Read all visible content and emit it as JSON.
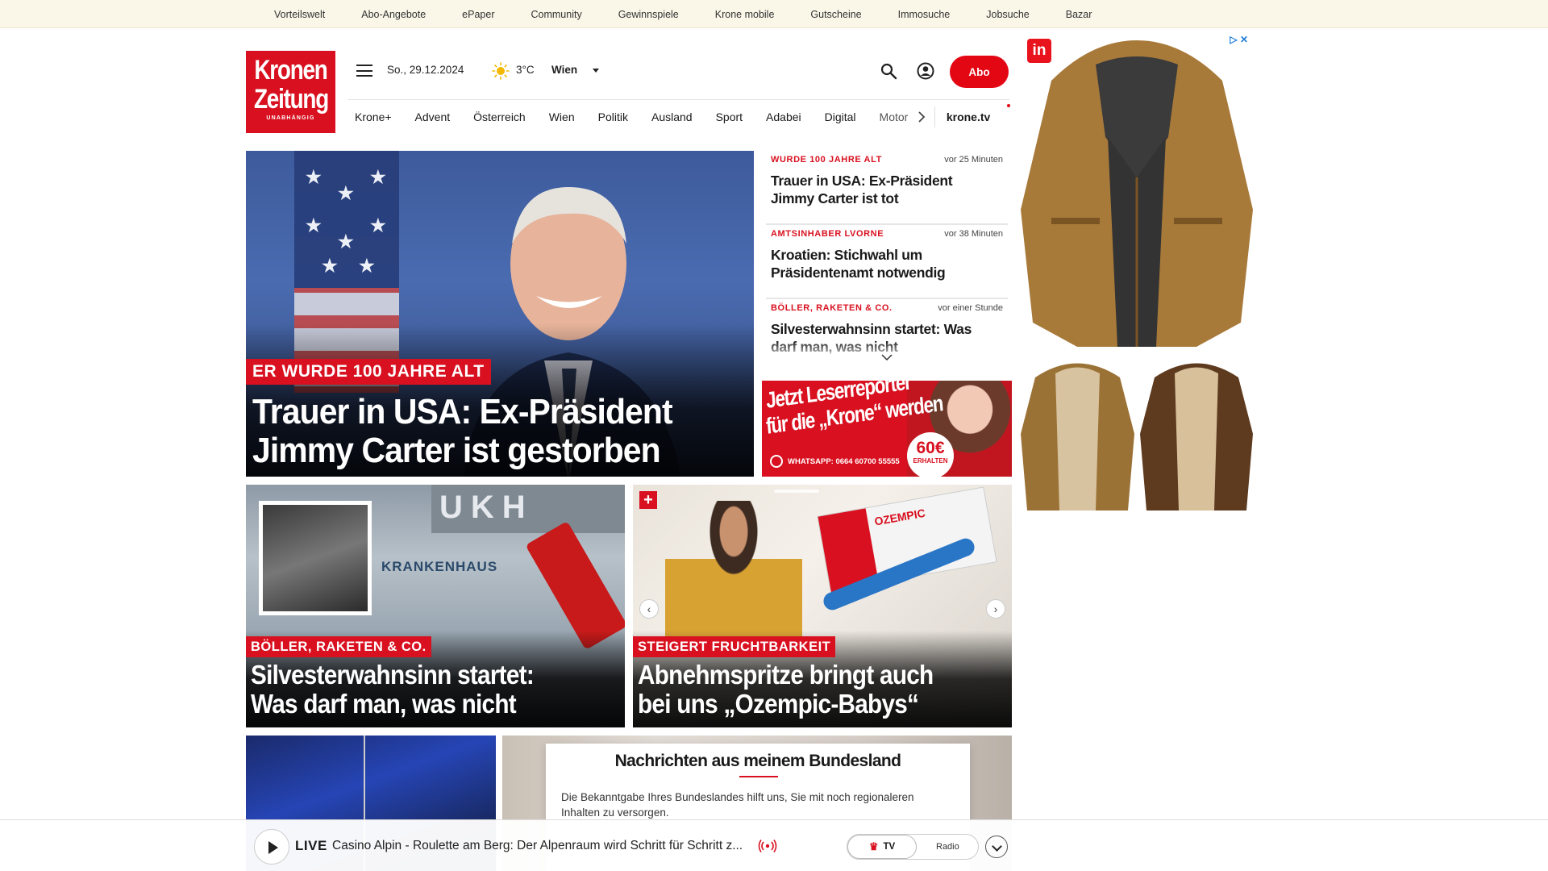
{
  "topbar": {
    "links": [
      "Vorteilswelt",
      "Abo-Angebote",
      "ePaper",
      "Community",
      "Gewinnspiele",
      "Krone mobile",
      "Gutscheine",
      "Immosuche",
      "Jobsuche",
      "Bazar"
    ]
  },
  "logo": {
    "line1": "Kronen",
    "line2": "Zeitung",
    "line3": "UNABHÄNGIG"
  },
  "header": {
    "date": "So., 29.12.2024",
    "temperature": "3°C",
    "city": "Wien",
    "abo_label": "Abo",
    "icons": {
      "menu": "hamburger-icon",
      "weather": "sun-icon",
      "search": "search-icon",
      "account": "user-icon"
    }
  },
  "nav": {
    "items": [
      "Krone+",
      "Advent",
      "Österreich",
      "Wien",
      "Politik",
      "Ausland",
      "Sport",
      "Adabei",
      "Digital",
      "Motor"
    ],
    "tv_label": "krone.tv"
  },
  "hero": {
    "kicker": "ER WURDE 100 JAHRE ALT",
    "title": "Trauer in USA: Ex-Präsident Jimmy Carter ist gestorben"
  },
  "news_list": [
    {
      "tag": "WURDE 100 JAHRE ALT",
      "time": "vor 25 Minuten",
      "headline": "Trauer in USA: Ex-Präsident Jimmy Carter ist tot"
    },
    {
      "tag": "AMTSINHABER LVORNE",
      "time": "vor 38 Minuten",
      "headline": "Kroatien: Stichwahl um Präsidentenamt notwendig"
    },
    {
      "tag": "BÖLLER, RAKETEN & CO.",
      "time": "vor einer Stunde",
      "headline": "Silvesterwahnsinn startet: Was darf man, was nicht"
    }
  ],
  "leserreporter": {
    "line1": "Jetzt Leserreporter",
    "line2": "für die „Krone“ werden",
    "whatsapp": "WHATSAPP: 0664 60700 55555",
    "badge_amount": "60€",
    "badge_text": "ERHALTEN"
  },
  "cards": [
    {
      "kicker": "BÖLLER, RAKETEN & CO.",
      "title": "Silvesterwahnsinn startet: Was darf man, was nicht",
      "sign": "UKH",
      "sign2": "KRANKENHAUS"
    },
    {
      "kicker": "STEIGERT FRUCHTBARKEIT",
      "title": "Abnehmspritze bringt auch bei uns „Ozempic-Babys“",
      "box_label": "OZEMPIC"
    }
  ],
  "bundesland": {
    "heading": "Nachrichten aus meinem Bundesland",
    "text": "Die Bekanntgabe Ihres Bundeslandes hilft uns, Sie mit noch regionaleren Inhalten zu versorgen."
  },
  "player": {
    "live_label": "LIVE",
    "title": "Casino Alpin - Roulette am Berg: Der Alpenraum wird Schritt für Schritt z...",
    "tv_label": "TV",
    "radio_label": "Radio"
  },
  "ad": {
    "brand": "in",
    "choices": "▷ ✕"
  },
  "colors": {
    "brand_red": "#d8101f",
    "abo_red": "#e30613",
    "topbar_bg": "#faf6e8"
  }
}
